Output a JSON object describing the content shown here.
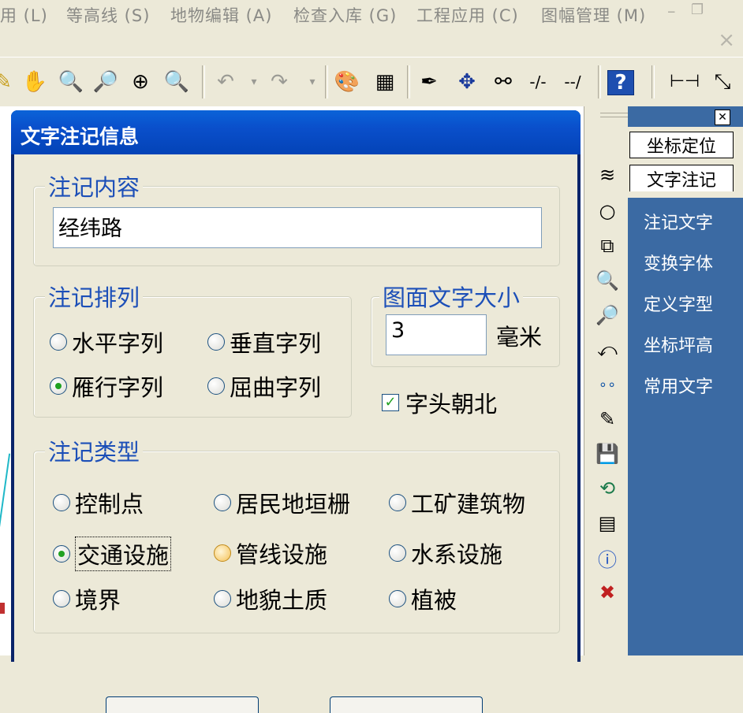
{
  "menubar": {
    "items": [
      "用 (L)",
      "等高线 (S)",
      "地物编辑 (A)",
      "检查入库 (G)",
      "工程应用 (C)",
      "图幅管理 (M)"
    ],
    "minimize": "–",
    "restore": "❐",
    "close": "×"
  },
  "dialog": {
    "title": "文字注记信息",
    "content_group": {
      "legend": "注记内容",
      "value": "经纬路"
    },
    "arrange_group": {
      "legend": "注记排列",
      "options": [
        "水平字列",
        "垂直字列",
        "雁行字列",
        "屈曲字列"
      ],
      "selected": "雁行字列"
    },
    "size_group": {
      "legend": "图面文字大小",
      "value": "3",
      "unit": "毫米"
    },
    "north_checkbox": {
      "label": "字头朝北",
      "checked": true
    },
    "type_group": {
      "legend": "注记类型",
      "options": [
        "控制点",
        "居民地垣栅",
        "工矿建筑物",
        "交通设施",
        "管线设施",
        "水系设施",
        "境界",
        "地貌土质",
        "植被"
      ],
      "selected": "交通设施"
    }
  },
  "side_panel": {
    "buttons": [
      "坐标定位",
      "文字注记"
    ],
    "links": [
      "注记文字",
      "变换字体",
      "定义字型",
      "坐标坪高",
      "常用文字"
    ]
  },
  "colors": {
    "title_bar": "#0a4fcb",
    "panel_bg": "#3b6aa3",
    "legend_text": "#1c4fb8"
  }
}
